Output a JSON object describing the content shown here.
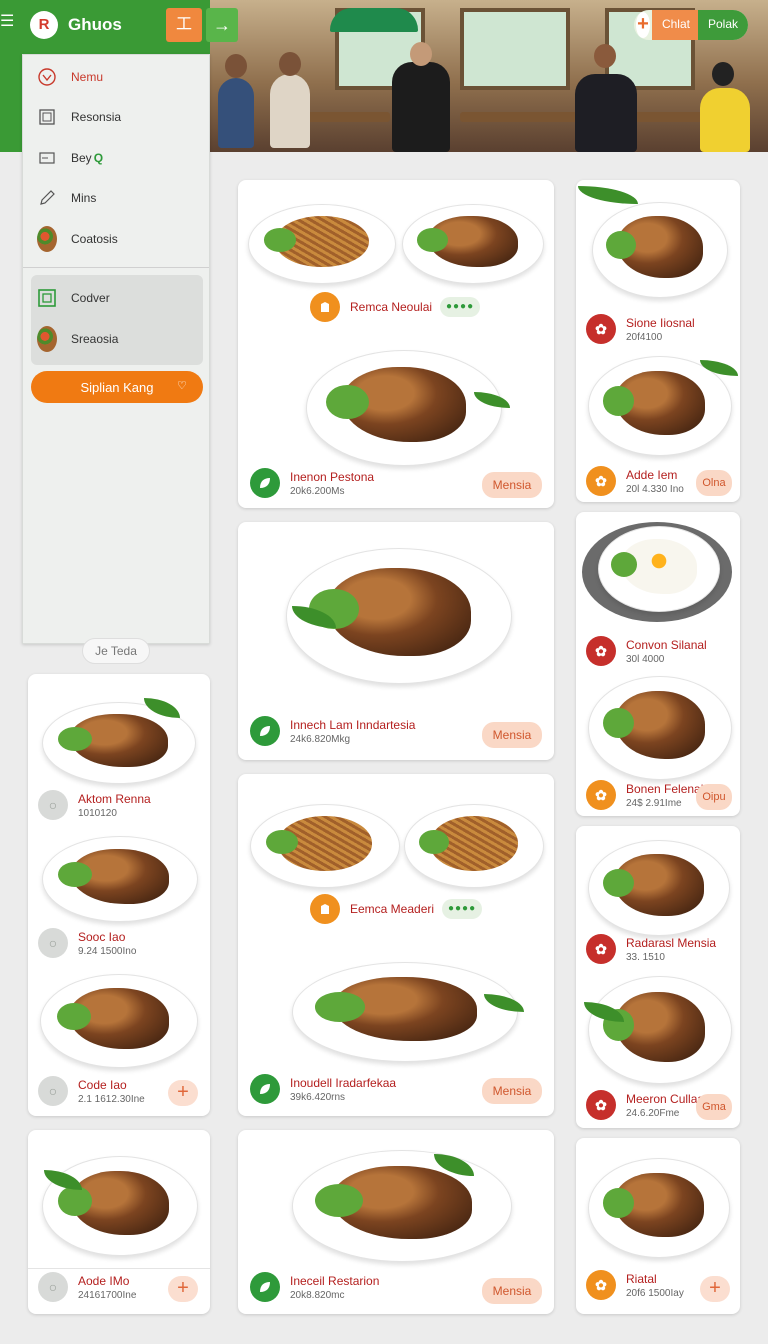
{
  "header": {
    "brand_name": "Ghuos",
    "brand_logo_letter": "R",
    "orange_button_glyph": "工",
    "green_button_glyph": "→"
  },
  "hero_cta": {
    "label_primary": "Chlat",
    "label_secondary": "Polak"
  },
  "sidebar": {
    "items": [
      {
        "label": "Nemu",
        "icon": "heart-outline-icon"
      },
      {
        "label": "Resonsia",
        "icon": "square-icon"
      },
      {
        "label": "Bey",
        "search_glyph": "Q",
        "icon": "card-icon"
      },
      {
        "label": "Mins",
        "icon": "pencil-icon"
      },
      {
        "label": "Coatosis",
        "icon": "food-thumbnail"
      },
      {
        "label": "Codver",
        "icon": "green-square-icon"
      },
      {
        "label": "Sreaosia",
        "icon": "food-thumbnail"
      }
    ],
    "cta_label": "Siplian Kang"
  },
  "tag_pill": "Je Teda",
  "cards": {
    "c1": {
      "top_name": "Remca Neoulai",
      "top_rating": "●●●●",
      "bottom_name": "Inenon Pestona",
      "bottom_sub": "20k6.200Ms",
      "button": "Mensia"
    },
    "c2": {
      "name": "Innech Lam Inndartesia",
      "sub": "24k6.820Mkg",
      "button": "Mensia"
    },
    "c3": {
      "top_name": "Eemca Meaderi",
      "top_rating": "●●●●",
      "bottom_name": "Inoudell Iradarfekaa",
      "bottom_sub": "39k6.420rns",
      "button": "Mensia"
    },
    "c4": {
      "name": "Ineceil Restarion",
      "sub": "20k8.820mc",
      "button": "Mensia"
    },
    "r1": {
      "a_name": "Sione Iiosnal",
      "a_sub": "20f4100",
      "b_name": "Adde Iem",
      "b_sub": "20l 4.330 Ino",
      "button": "Olna"
    },
    "r2": {
      "a_name": "Convon Silanal",
      "a_sub": "30l 4000",
      "b_name": "Bonen Felenal",
      "b_sub": "24$ 2.91Ime",
      "button": "Oipu"
    },
    "r3": {
      "a_name": "Radarasl Mensia",
      "a_sub": "33. 1510",
      "b_name": "Meeron Cullaai",
      "b_sub": "24.6.20Fme",
      "button": "Gma"
    },
    "r4": {
      "name": "Riatal",
      "sub": "20f6 1500Iay"
    },
    "l1": {
      "a_name": "Aktom Renna",
      "a_sub": "1010120",
      "b_name": "Sooc Iao",
      "b_sub": "9.24 1500Ino",
      "c_name": "Code Iao",
      "c_sub": "2.1 1612.30Ine"
    },
    "l2": {
      "name": "Aode IMo",
      "sub": "24161700Ine"
    }
  },
  "colors": {
    "brand_green": "#3a9a35",
    "accent_orange": "#f07a12",
    "dish_name_red": "#b4201f",
    "pill_bg": "#fad8c6"
  }
}
